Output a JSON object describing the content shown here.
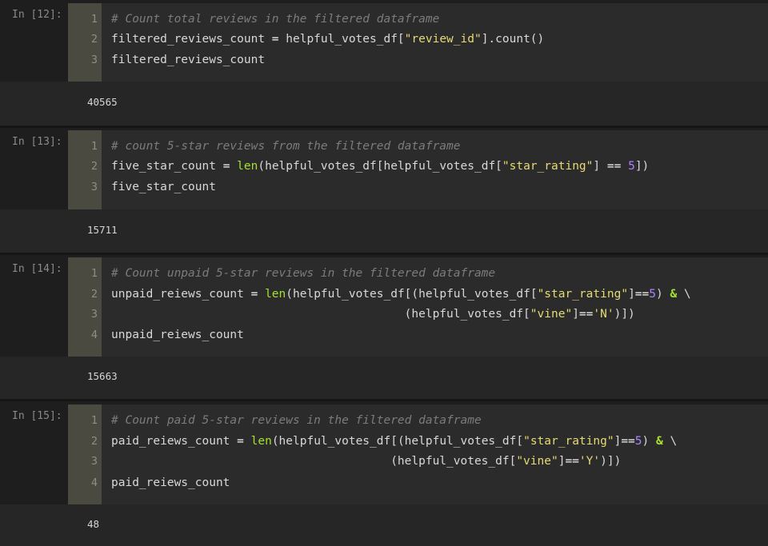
{
  "cells": [
    {
      "prompt": "In [12]:",
      "lines": [
        {
          "n": "1",
          "parts": [
            {
              "t": "# Count total reviews in the filtered dataframe",
              "c": "cmt"
            }
          ]
        },
        {
          "n": "2",
          "parts": [
            {
              "t": "filtered_reviews_count ",
              "c": ""
            },
            {
              "t": "=",
              "c": "op"
            },
            {
              "t": " helpful_votes_df[",
              "c": ""
            },
            {
              "t": "\"review_id\"",
              "c": "str"
            },
            {
              "t": "].count()",
              "c": ""
            }
          ]
        },
        {
          "n": "3",
          "parts": [
            {
              "t": "filtered_reviews_count",
              "c": ""
            }
          ]
        }
      ],
      "output": "40565"
    },
    {
      "prompt": "In [13]:",
      "lines": [
        {
          "n": "1",
          "parts": [
            {
              "t": "# count 5-star reviews from the filtered dataframe",
              "c": "cmt"
            }
          ]
        },
        {
          "n": "2",
          "parts": [
            {
              "t": "five_star_count ",
              "c": ""
            },
            {
              "t": "=",
              "c": "op"
            },
            {
              "t": " ",
              "c": ""
            },
            {
              "t": "len",
              "c": "fn"
            },
            {
              "t": "(helpful_votes_df[helpful_votes_df[",
              "c": ""
            },
            {
              "t": "\"star_rating\"",
              "c": "str"
            },
            {
              "t": "] ",
              "c": ""
            },
            {
              "t": "==",
              "c": "op"
            },
            {
              "t": " ",
              "c": ""
            },
            {
              "t": "5",
              "c": "num"
            },
            {
              "t": "])",
              "c": ""
            }
          ]
        },
        {
          "n": "3",
          "parts": [
            {
              "t": "five_star_count",
              "c": ""
            }
          ]
        }
      ],
      "output": "15711"
    },
    {
      "prompt": "In [14]:",
      "lines": [
        {
          "n": "1",
          "parts": [
            {
              "t": "# Count unpaid 5-star reviews in the filtered dataframe",
              "c": "cmt"
            }
          ]
        },
        {
          "n": "2",
          "parts": [
            {
              "t": "unpaid_reiews_count ",
              "c": ""
            },
            {
              "t": "=",
              "c": "op"
            },
            {
              "t": " ",
              "c": ""
            },
            {
              "t": "len",
              "c": "fn"
            },
            {
              "t": "(helpful_votes_df[(helpful_votes_df[",
              "c": ""
            },
            {
              "t": "\"star_rating\"",
              "c": "str"
            },
            {
              "t": "]",
              "c": ""
            },
            {
              "t": "==",
              "c": "op"
            },
            {
              "t": "5",
              "c": "num"
            },
            {
              "t": ") ",
              "c": ""
            },
            {
              "t": "&",
              "c": "kw"
            },
            {
              "t": " \\",
              "c": ""
            }
          ]
        },
        {
          "n": "3",
          "parts": [
            {
              "t": "                                          (helpful_votes_df[",
              "c": ""
            },
            {
              "t": "\"vine\"",
              "c": "str"
            },
            {
              "t": "]",
              "c": ""
            },
            {
              "t": "==",
              "c": "op"
            },
            {
              "t": "'N'",
              "c": "str"
            },
            {
              "t": ")])",
              "c": ""
            }
          ]
        },
        {
          "n": "4",
          "parts": [
            {
              "t": "unpaid_reiews_count",
              "c": ""
            }
          ]
        }
      ],
      "output": "15663"
    },
    {
      "prompt": "In [15]:",
      "lines": [
        {
          "n": "1",
          "parts": [
            {
              "t": "# Count paid 5-star reviews in the filtered dataframe",
              "c": "cmt"
            }
          ]
        },
        {
          "n": "2",
          "parts": [
            {
              "t": "paid_reiews_count ",
              "c": ""
            },
            {
              "t": "=",
              "c": "op"
            },
            {
              "t": " ",
              "c": ""
            },
            {
              "t": "len",
              "c": "fn"
            },
            {
              "t": "(helpful_votes_df[(helpful_votes_df[",
              "c": ""
            },
            {
              "t": "\"star_rating\"",
              "c": "str"
            },
            {
              "t": "]",
              "c": ""
            },
            {
              "t": "==",
              "c": "op"
            },
            {
              "t": "5",
              "c": "num"
            },
            {
              "t": ") ",
              "c": ""
            },
            {
              "t": "&",
              "c": "kw"
            },
            {
              "t": " \\",
              "c": ""
            }
          ]
        },
        {
          "n": "3",
          "parts": [
            {
              "t": "                                        (helpful_votes_df[",
              "c": ""
            },
            {
              "t": "\"vine\"",
              "c": "str"
            },
            {
              "t": "]",
              "c": ""
            },
            {
              "t": "==",
              "c": "op"
            },
            {
              "t": "'Y'",
              "c": "str"
            },
            {
              "t": ")])",
              "c": ""
            }
          ]
        },
        {
          "n": "4",
          "parts": [
            {
              "t": "paid_reiews_count",
              "c": ""
            }
          ]
        }
      ],
      "output": "48"
    }
  ]
}
